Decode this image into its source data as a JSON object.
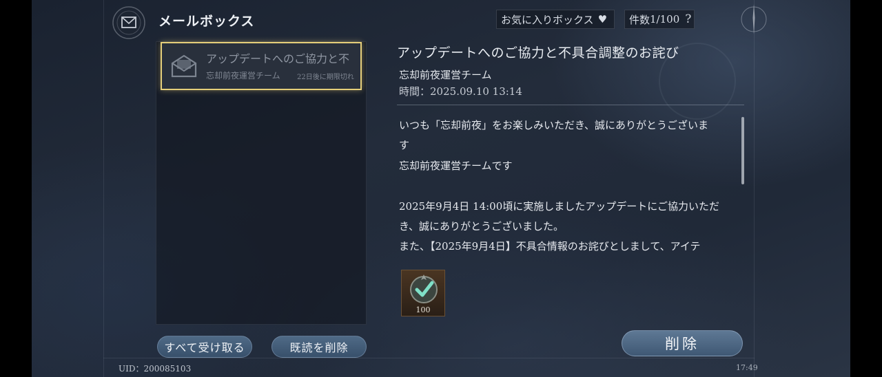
{
  "header": {
    "title": "メールボックス",
    "favorite_label": "お気に入りボックス",
    "count_label": "件数",
    "count_value": "1/100",
    "help_symbol": "?"
  },
  "mail_list": {
    "items": [
      {
        "subject": "アップデートへのご協力と不",
        "sender": "忘却前夜運営チーム",
        "expires": "22日後に期限切れ"
      }
    ]
  },
  "actions": {
    "claim_all": "すべて受け取る",
    "delete_read": "既読を削除",
    "delete": "削除"
  },
  "detail": {
    "title": "アップデートへのご協力と不具合調整のお詫び",
    "sender": "忘却前夜運営チーム",
    "time_label": "時間：",
    "time_value": "2025.09.10 13:14",
    "body_lines": [
      "いつも「忘却前夜」をお楽しみいただき、誠にありがとうございま",
      "す",
      "忘却前夜運営チームです",
      "",
      "2025年9月4日 14:00頃に実施しましたアップデートにご協力いただ",
      "き、誠にありがとうございました。",
      "また、【2025年9月4日】不具合情報のお詫びとしまして、アイテ"
    ],
    "attachment": {
      "icon": "check-emblem-icon",
      "quantity": "100"
    }
  },
  "footer": {
    "uid_label": "UID：",
    "uid_value": "200085103",
    "clock": "17:49"
  },
  "colors": {
    "highlight_border": "#e6cf7a",
    "button_blue": "#4f6a86",
    "item_frame": "#6b5135"
  }
}
